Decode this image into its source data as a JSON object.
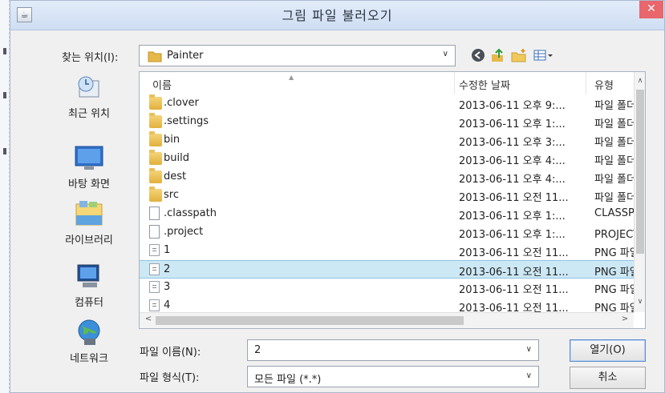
{
  "window": {
    "title": "그림 파일 불러오기",
    "close_glyph": "✕"
  },
  "lookin": {
    "label": "찾는 위치(I):",
    "value": "Painter"
  },
  "toolbar": {
    "back_glyph": "◀",
    "up_glyph": "⬆",
    "newfolder_glyph": "✚",
    "view_glyph": "▦▾"
  },
  "places": [
    {
      "name": "최근 위치",
      "icon": "recent-places-icon"
    },
    {
      "name": "바탕 화면",
      "icon": "desktop-icon"
    },
    {
      "name": "라이브러리",
      "icon": "libraries-icon"
    },
    {
      "name": "컴퓨터",
      "icon": "computer-icon"
    },
    {
      "name": "네트워크",
      "icon": "network-icon"
    }
  ],
  "columns": {
    "name": "이름",
    "date": "수정한 날짜",
    "type": "유형"
  },
  "files": [
    {
      "name": ".clover",
      "date": "2013-06-11 오후 9:...",
      "type": "파일 폴더",
      "icon": "folder"
    },
    {
      "name": ".settings",
      "date": "2013-06-11 오후 1:...",
      "type": "파일 폴더",
      "icon": "folder"
    },
    {
      "name": "bin",
      "date": "2013-06-11 오후 3:...",
      "type": "파일 폴더",
      "icon": "folder"
    },
    {
      "name": "build",
      "date": "2013-06-11 오후 4:...",
      "type": "파일 폴더",
      "icon": "folder"
    },
    {
      "name": "dest",
      "date": "2013-06-11 오후 4:...",
      "type": "파일 폴더",
      "icon": "folder"
    },
    {
      "name": "src",
      "date": "2013-06-11 오전 11...",
      "type": "파일 폴더",
      "icon": "folder"
    },
    {
      "name": ".classpath",
      "date": "2013-06-11 오후 1:...",
      "type": "CLASSPATH",
      "icon": "file"
    },
    {
      "name": ".project",
      "date": "2013-06-11 오후 1:...",
      "type": "PROJECT 파",
      "icon": "file"
    },
    {
      "name": "1",
      "date": "2013-06-11 오전 11...",
      "type": "PNG 파일",
      "icon": "png"
    },
    {
      "name": "2",
      "date": "2013-06-11 오전 11...",
      "type": "PNG 파일",
      "icon": "png",
      "selected": true
    },
    {
      "name": "3",
      "date": "2013-06-11 오전 11...",
      "type": "PNG 파일",
      "icon": "png"
    },
    {
      "name": "4",
      "date": "2013-06-11 오전 11...",
      "type": "PNG 파일",
      "icon": "png"
    }
  ],
  "scroll": {
    "up": "∧",
    "down": "∨",
    "left": "<",
    "right": ">"
  },
  "filename": {
    "label": "파일 이름(N):",
    "value": "2"
  },
  "filetype": {
    "label": "파일 형식(T):",
    "value": "모든 파일 (*.*)"
  },
  "buttons": {
    "open": "열기(O)",
    "cancel": "취소"
  },
  "dropdown_glyph": "∨",
  "colors": {
    "selection": "#cce8f4",
    "titlebar": "#dbe7f7",
    "close": "#e8666c"
  }
}
